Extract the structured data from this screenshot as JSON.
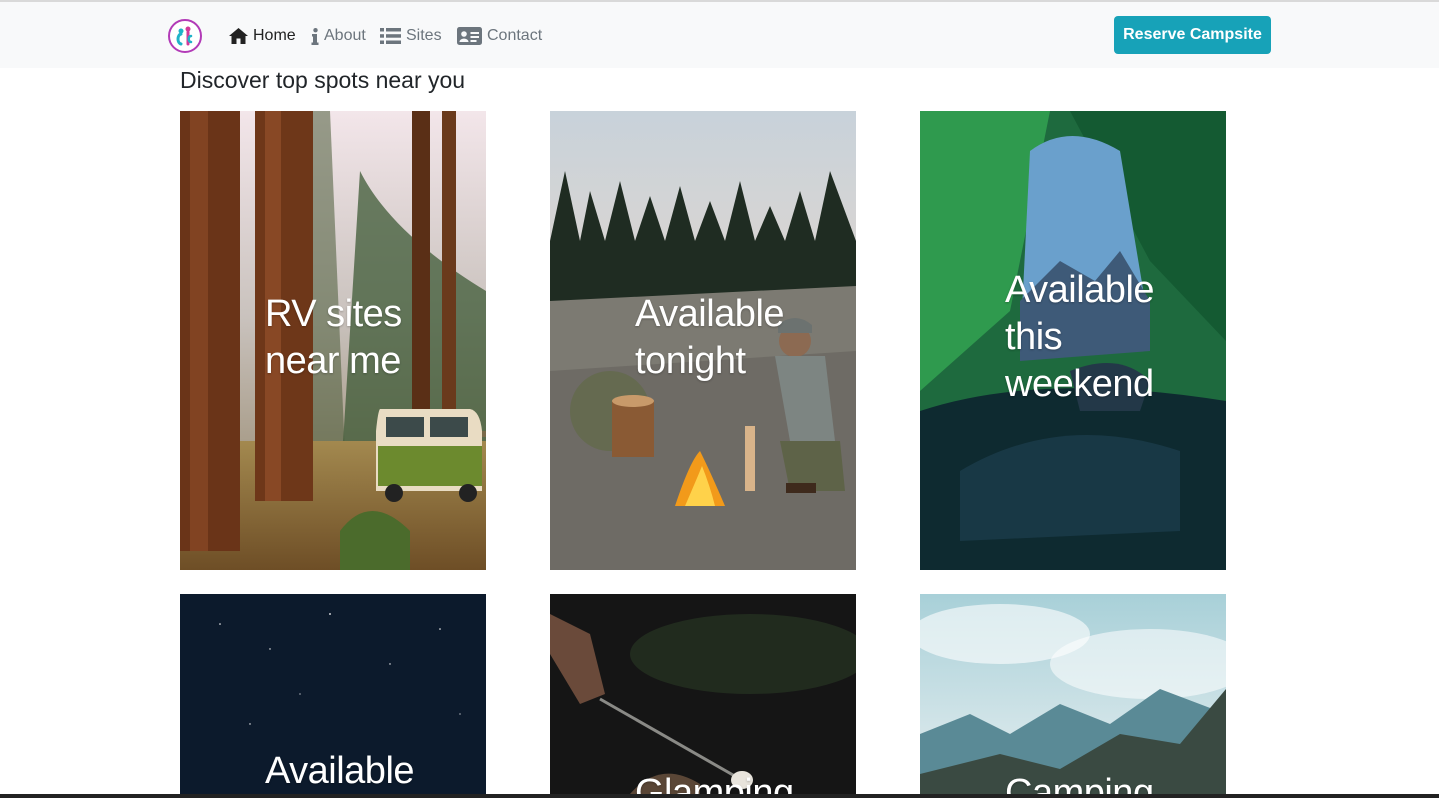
{
  "navbar": {
    "logo_icon": "rc-logo-icon",
    "links": [
      {
        "label": "Home",
        "icon": "home-icon",
        "active": true
      },
      {
        "label": "About",
        "icon": "info-icon",
        "active": false
      },
      {
        "label": "Sites",
        "icon": "list-icon",
        "active": false
      },
      {
        "label": "Contact",
        "icon": "contact-card-icon",
        "active": false
      }
    ],
    "cta_label": "Reserve Campsite"
  },
  "main": {
    "heading": "Discover top spots near you",
    "cards": [
      {
        "label": "RV sites near me"
      },
      {
        "label": "Available tonight"
      },
      {
        "label": "Available this weekend"
      },
      {
        "label": "Available"
      },
      {
        "label": "Glamping"
      },
      {
        "label": "Camping"
      }
    ]
  },
  "colors": {
    "accent": "#17a2b8",
    "navbar_bg": "#f8f9fa",
    "text_dark": "#212529",
    "nav_muted": "#6c757d"
  }
}
